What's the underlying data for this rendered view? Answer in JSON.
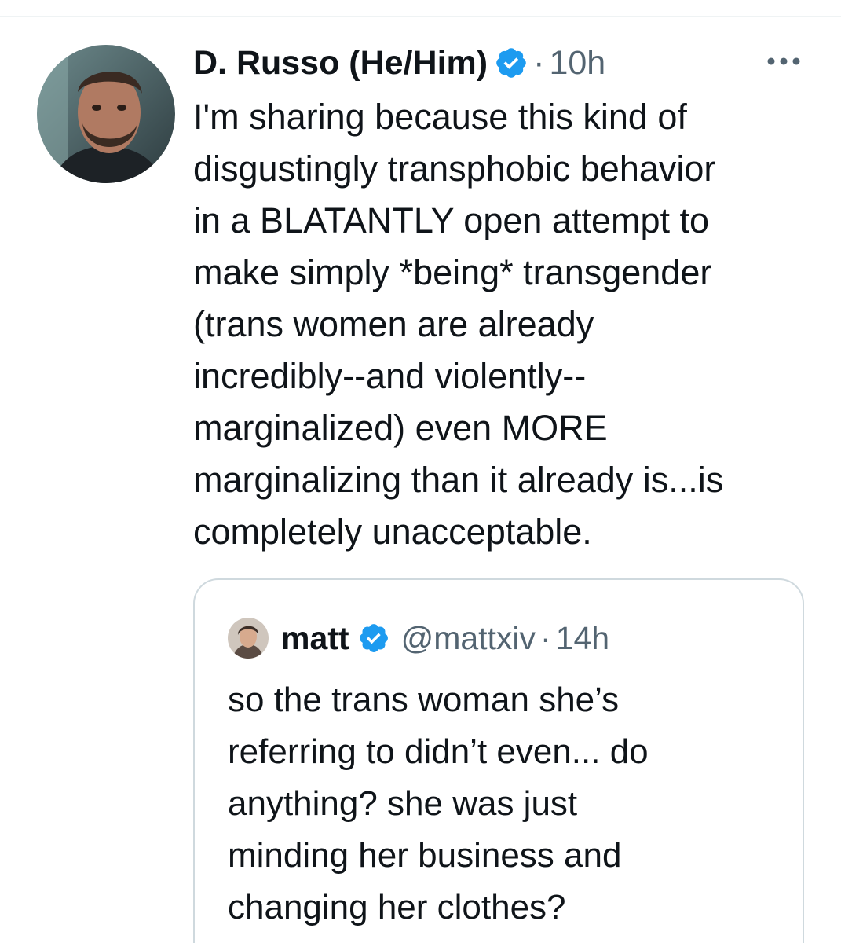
{
  "tweet": {
    "author": {
      "display_name": "D. Russo (He/Him)",
      "avatar_icon": "profile-photo",
      "verified_icon": "verified-badge-icon"
    },
    "separator": "·",
    "time": "10h",
    "more_icon": "more-options-icon",
    "text": "I'm sharing because this kind of\ndisgustingly transphobic behavior\nin a BLATANTLY open attempt to\nmake simply *being* transgender\n(trans women are already\nincredibly--and violently--\nmarginalized) even MORE\nmarginalizing than it already is...is\ncompletely unacceptable."
  },
  "quoted_tweet": {
    "author": {
      "display_name": "matt",
      "handle": "@mattxiv",
      "avatar_icon": "profile-photo",
      "verified_icon": "verified-badge-icon"
    },
    "separator": "·",
    "time": "14h",
    "text": "so the trans woman she’s\nreferring to didn’t even... do\nanything? she was just\nminding her business and\nchanging her clothes?"
  },
  "colors": {
    "primary_text": "#0f1419",
    "secondary_text": "#536471",
    "verified_blue": "#1d9bf0",
    "border": "#cfd9de",
    "background": "#ffffff"
  }
}
